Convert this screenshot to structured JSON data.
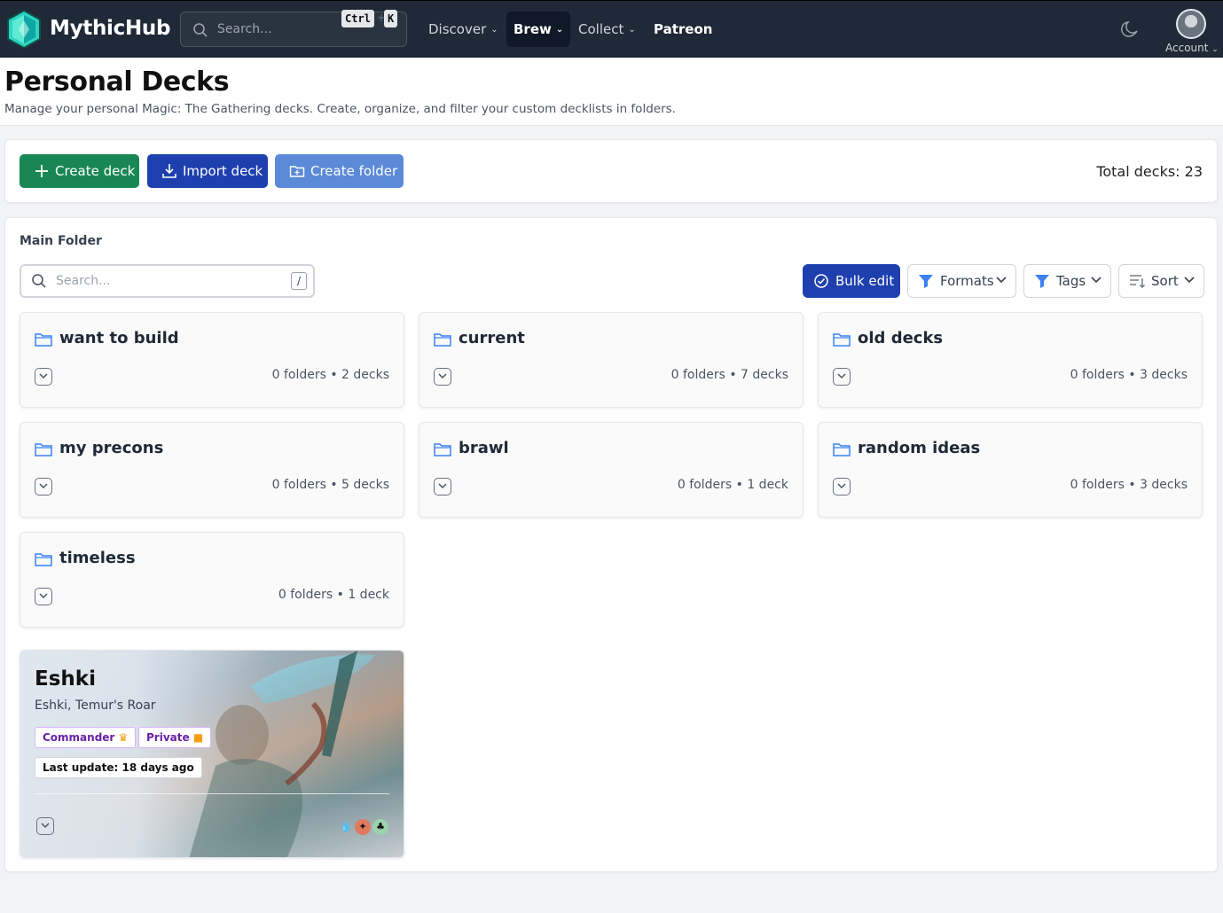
{
  "nav": {
    "brand": "MythicHub",
    "search_placeholder": "Search...",
    "kbd_ctrl": "Ctrl",
    "kbd_k": "K",
    "items": [
      {
        "label": "Discover"
      },
      {
        "label": "Brew"
      },
      {
        "label": "Collect"
      },
      {
        "label": "Patreon"
      }
    ],
    "account_label": "Account"
  },
  "header": {
    "title": "Personal Decks",
    "subtitle": "Manage your personal Magic: The Gathering decks. Create, organize, and filter your custom decklists in folders."
  },
  "actions": {
    "create_deck": "Create deck",
    "import_deck": "Import deck",
    "create_folder": "Create folder",
    "total": "Total decks: 23"
  },
  "main": {
    "label": "Main Folder",
    "search_placeholder": "Search...",
    "slash": "/",
    "bulk_edit": "Bulk edit",
    "formats": "Formats",
    "tags": "Tags",
    "sort": "Sort"
  },
  "folders": [
    {
      "name": "want to build",
      "count": "0 folders • 2 decks"
    },
    {
      "name": "current",
      "count": "0 folders • 7 decks"
    },
    {
      "name": "old decks",
      "count": "0 folders • 3 decks"
    },
    {
      "name": "my precons",
      "count": "0 folders • 5 decks"
    },
    {
      "name": "brawl",
      "count": "0 folders • 1 deck"
    },
    {
      "name": "random ideas",
      "count": "0 folders • 3 decks"
    },
    {
      "name": "timeless",
      "count": "0 folders • 1 deck"
    }
  ],
  "deck": {
    "name": "Eshki",
    "commander": "Eshki, Temur's Roar",
    "format_tag": "Commander",
    "visibility_tag": "Private",
    "last_update": "Last update: 18 days ago",
    "mana": [
      "blue",
      "red",
      "green"
    ]
  },
  "colors": {
    "navbar": "#1f2937",
    "create_deck": "#198754",
    "import_deck": "#1e40af",
    "create_folder": "#5b8ad6",
    "bulk_edit": "#1e40af"
  }
}
